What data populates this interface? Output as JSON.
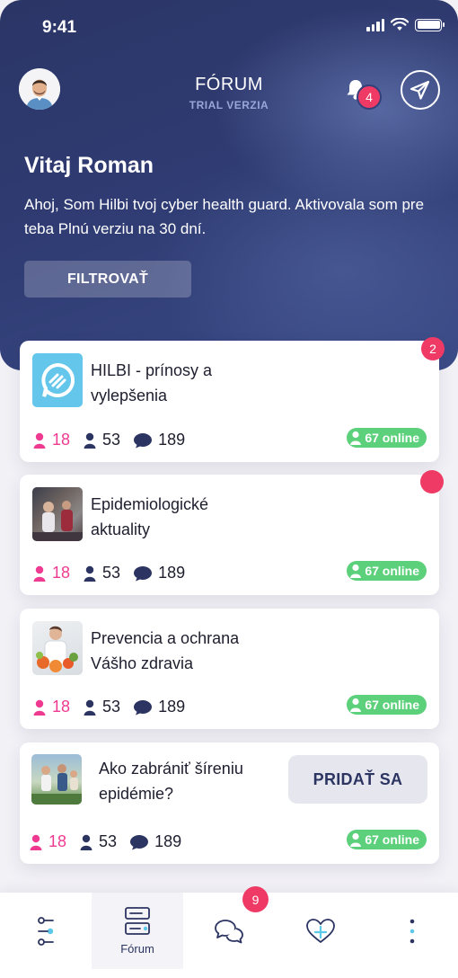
{
  "status_bar": {
    "time": "9:41"
  },
  "header": {
    "title": "FÓRUM",
    "subtitle": "TRIAL VERZIA",
    "notification_count": "4",
    "greeting": "Vitaj Roman",
    "intro": "Ahoj, Som Hilbi tvoj cyber health guard. Aktivovala som pre teba Plnú verziu na 30 dní.",
    "filter_label": "FILTROVAŤ"
  },
  "cards": [
    {
      "title": "HILBI - prínosy a vylepšenia",
      "women": "18",
      "users": "53",
      "comments": "189",
      "online": "67 online",
      "badge": "2"
    },
    {
      "title": "Epidemiologické aktuality",
      "women": "18",
      "users": "53",
      "comments": "189",
      "online": "67 online"
    },
    {
      "title": "Prevencia a ochrana Vášho zdravia",
      "women": "18",
      "users": "53",
      "comments": "189",
      "online": "67 online"
    },
    {
      "title": "Ako zabrániť šíreniu epidémie?",
      "women": "18",
      "users": "53",
      "comments": "189",
      "online": "67 online",
      "join_label": "PRIDAŤ SA"
    }
  ],
  "tabbar": {
    "forum_label": "Fórum",
    "messages_badge": "9"
  },
  "colors": {
    "header_bg": "#2f3b72",
    "badge": "#ee3a65",
    "online": "#5dd07c",
    "accent_pink": "#ee3a90",
    "navy": "#2c3462"
  },
  "icons": [
    "signal-icon",
    "wifi-icon",
    "battery-icon",
    "bell-icon",
    "send-icon",
    "woman-icon",
    "user-icon",
    "comment-icon",
    "filter-icon",
    "forum-icon",
    "chat-icon",
    "heart-icon",
    "more-icon"
  ]
}
